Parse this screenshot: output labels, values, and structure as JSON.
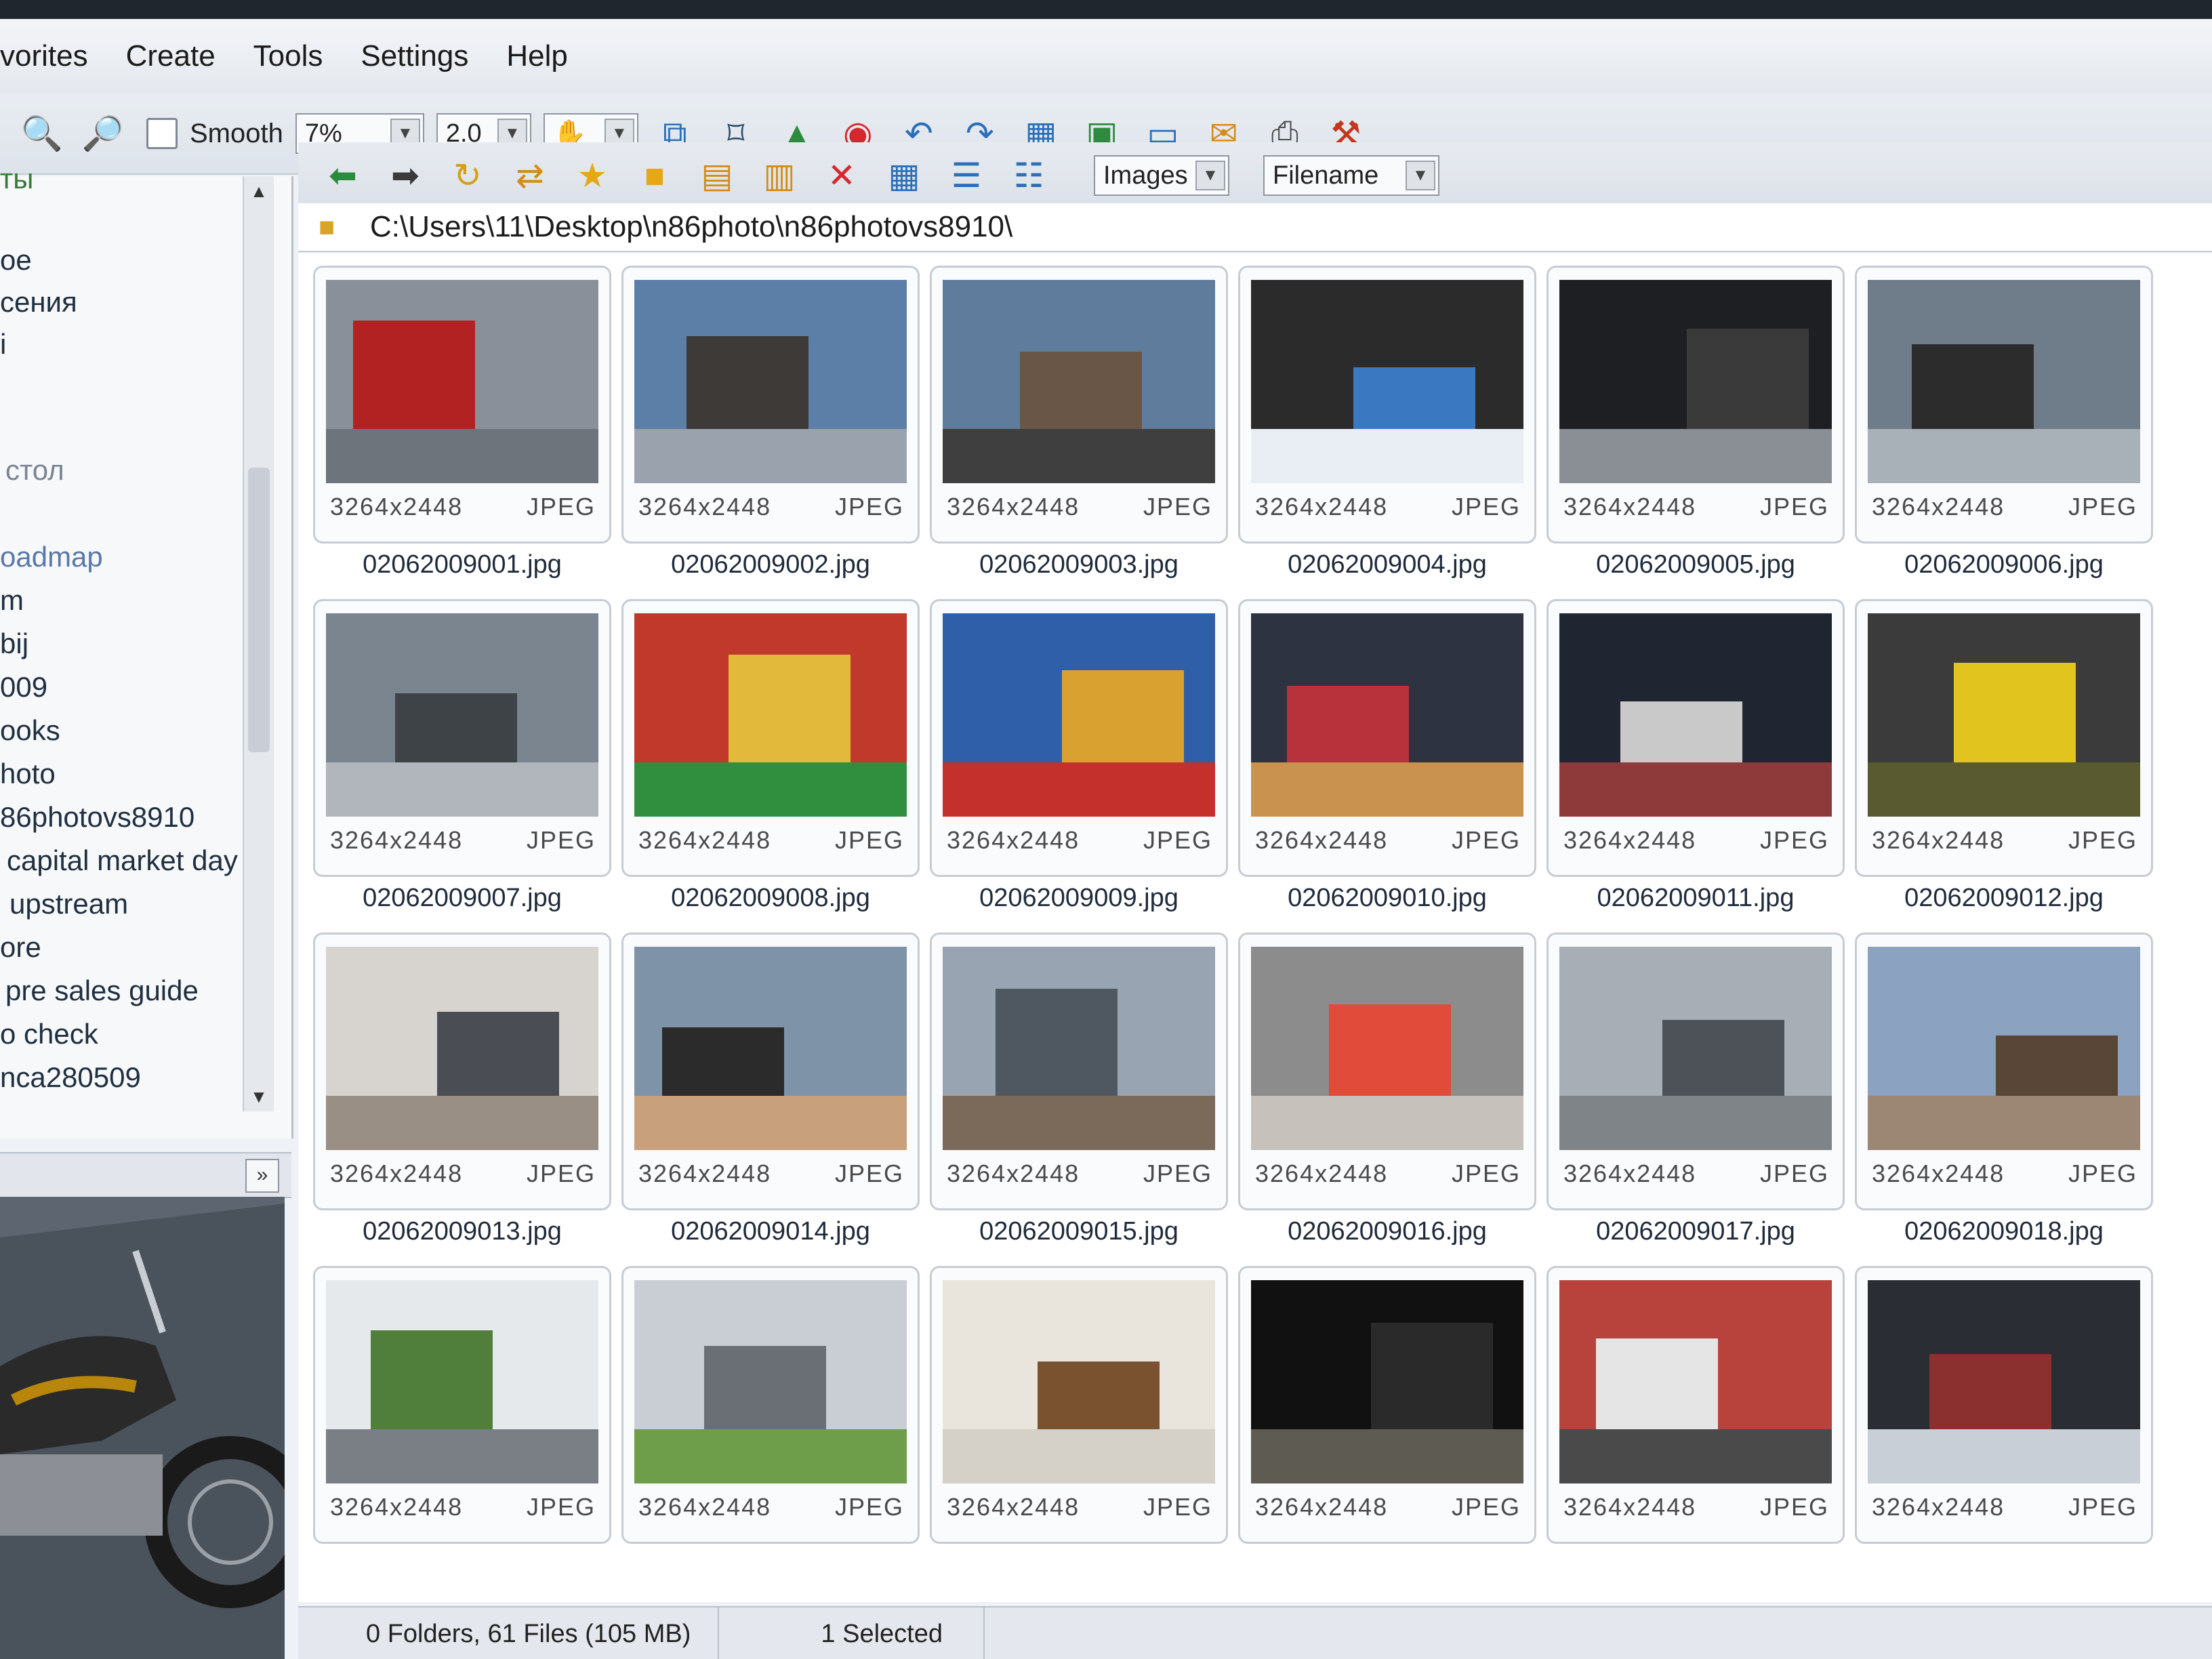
{
  "menu": [
    "vorites",
    "Create",
    "Tools",
    "Settings",
    "Help"
  ],
  "toolbar": {
    "smooth_label": "Smooth",
    "zoom_value": "7%",
    "ratio_value": "2.0"
  },
  "toolbar2": {
    "filter_value": "Images",
    "sort_value": "Filename"
  },
  "address": {
    "path": "C:\\Users\\11\\Desktop\\n86photo\\n86photovs8910\\"
  },
  "tree": {
    "items": [
      "ты",
      "ое",
      "сения",
      "i",
      "стол",
      "oadmap",
      "m",
      "bij",
      "009",
      "ooks",
      "hoto",
      "86photovs8910",
      "capital market day",
      "upstream",
      "ore",
      "pre sales guide",
      "o check",
      "nca280509"
    ]
  },
  "thumbnails": [
    {
      "file": "02062009001.jpg",
      "dims": "3264x2448",
      "format": "JPEG"
    },
    {
      "file": "02062009002.jpg",
      "dims": "3264x2448",
      "format": "JPEG"
    },
    {
      "file": "02062009003.jpg",
      "dims": "3264x2448",
      "format": "JPEG"
    },
    {
      "file": "02062009004.jpg",
      "dims": "3264x2448",
      "format": "JPEG"
    },
    {
      "file": "02062009005.jpg",
      "dims": "3264x2448",
      "format": "JPEG"
    },
    {
      "file": "02062009006.jpg",
      "dims": "3264x2448",
      "format": "JPEG"
    },
    {
      "file": "02062009007.jpg",
      "dims": "3264x2448",
      "format": "JPEG"
    },
    {
      "file": "02062009008.jpg",
      "dims": "3264x2448",
      "format": "JPEG"
    },
    {
      "file": "02062009009.jpg",
      "dims": "3264x2448",
      "format": "JPEG"
    },
    {
      "file": "02062009010.jpg",
      "dims": "3264x2448",
      "format": "JPEG"
    },
    {
      "file": "02062009011.jpg",
      "dims": "3264x2448",
      "format": "JPEG"
    },
    {
      "file": "02062009012.jpg",
      "dims": "3264x2448",
      "format": "JPEG"
    },
    {
      "file": "02062009013.jpg",
      "dims": "3264x2448",
      "format": "JPEG"
    },
    {
      "file": "02062009014.jpg",
      "dims": "3264x2448",
      "format": "JPEG"
    },
    {
      "file": "02062009015.jpg",
      "dims": "3264x2448",
      "format": "JPEG"
    },
    {
      "file": "02062009016.jpg",
      "dims": "3264x2448",
      "format": "JPEG"
    },
    {
      "file": "02062009017.jpg",
      "dims": "3264x2448",
      "format": "JPEG"
    },
    {
      "file": "02062009018.jpg",
      "dims": "3264x2448",
      "format": "JPEG"
    },
    {
      "file": "",
      "dims": "3264x2448",
      "format": "JPEG"
    },
    {
      "file": "",
      "dims": "3264x2448",
      "format": "JPEG"
    },
    {
      "file": "",
      "dims": "3264x2448",
      "format": "JPEG"
    },
    {
      "file": "",
      "dims": "3264x2448",
      "format": "JPEG"
    },
    {
      "file": "",
      "dims": "3264x2448",
      "format": "JPEG"
    },
    {
      "file": "",
      "dims": "3264x2448",
      "format": "JPEG"
    }
  ],
  "status": {
    "summary": "0 Folders, 61 Files (105 MB)",
    "selected": "1 Selected"
  }
}
